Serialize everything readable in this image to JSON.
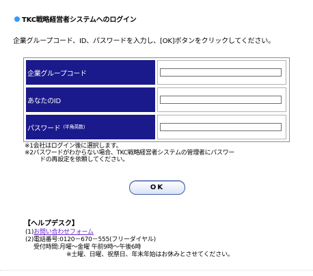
{
  "header": {
    "title": "TKC戦略経営者システムへのログイン"
  },
  "instruction": "企業グループコード、ID、パスワードを入力し、[OK]ボタンをクリックしてください。",
  "form": {
    "fields": [
      {
        "label": "企業グループコード",
        "sublabel": "",
        "value": ""
      },
      {
        "label": "あなたのID",
        "sublabel": "",
        "value": ""
      },
      {
        "label": "パスワード",
        "sublabel": "(半角英数)",
        "value": ""
      }
    ]
  },
  "notes": [
    "※1会社はログイン後に選択します。",
    "※2パスワードがわからない場合、TKC戦略経営者システムの管理者にパスワー",
    "ドの再設定を依頼してください。"
  ],
  "ok_button": {
    "label": "OK"
  },
  "help": {
    "title": "【ヘルプデスク】",
    "item1_prefix": "(1)",
    "item1_link": "お問い合わせフォーム",
    "item2": "(2)電話番号:0120－670－555(フリーダイヤル)",
    "item3": "受付時間:月曜～金曜 午前9時～午後6時",
    "item4": "※土曜、日曜、祝祭日、年末年始はお休みとさせてください。"
  },
  "colors": {
    "label_bg": "#1a1a8c",
    "bullet": "#3399ff",
    "link": "#6622cc"
  }
}
